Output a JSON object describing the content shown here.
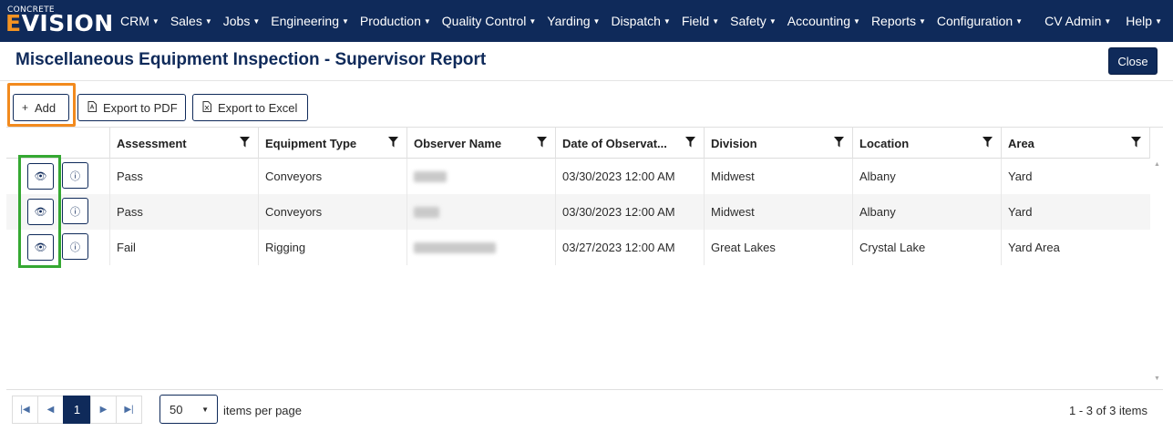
{
  "brand": {
    "small": "CONCRETE",
    "big_e": "E",
    "big_rest": "VISION"
  },
  "nav": {
    "menu": [
      "CRM",
      "Sales",
      "Jobs",
      "Engineering",
      "Production",
      "Quality Control",
      "Yarding",
      "Dispatch",
      "Field",
      "Safety",
      "Accounting",
      "Reports",
      "Configuration"
    ],
    "user": "CV Admin",
    "help": "Help"
  },
  "page": {
    "title": "Miscellaneous Equipment Inspection - Supervisor Report",
    "close_label": "Close"
  },
  "toolbar": {
    "add_label": "Add",
    "pdf_label": "Export to PDF",
    "excel_label": "Export to Excel"
  },
  "grid": {
    "columns": [
      "Assessment",
      "Equipment Type",
      "Observer Name",
      "Date of Observat...",
      "Division",
      "Location",
      "Area"
    ],
    "rows": [
      {
        "assessment": "Pass",
        "equipment_type": "Conveyors",
        "date": "03/30/2023 12:00 AM",
        "division": "Midwest",
        "location": "Albany",
        "area": "Yard"
      },
      {
        "assessment": "Pass",
        "equipment_type": "Conveyors",
        "date": "03/30/2023 12:00 AM",
        "division": "Midwest",
        "location": "Albany",
        "area": "Yard"
      },
      {
        "assessment": "Fail",
        "equipment_type": "Rigging",
        "date": "03/27/2023 12:00 AM",
        "division": "Great Lakes",
        "location": "Crystal Lake",
        "area": "Yard Area"
      }
    ]
  },
  "pager": {
    "current_page": "1",
    "page_size": "50",
    "per_page_label": "items per page",
    "info": "1 - 3 of 3 items"
  },
  "colors": {
    "navbar": "#0f2a5a",
    "accent": "#f39322",
    "highlight_orange": "#f28a1e",
    "highlight_green": "#35a832"
  }
}
